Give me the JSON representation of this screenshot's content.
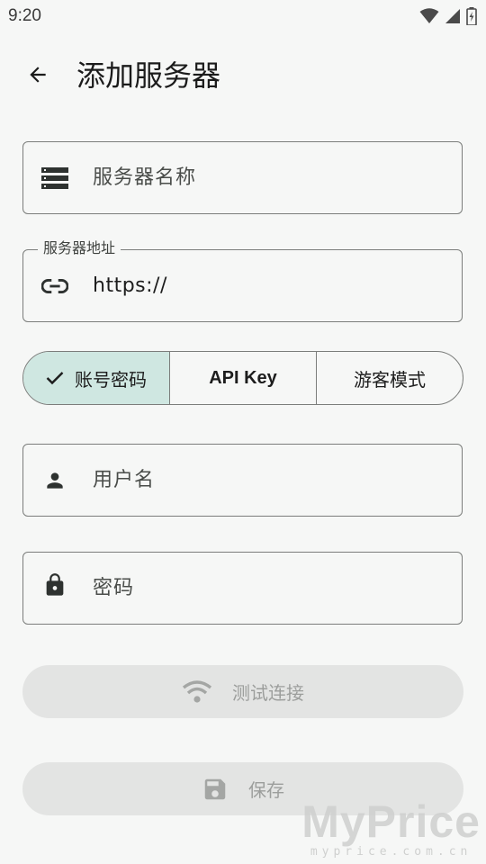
{
  "status_bar": {
    "time": "9:20",
    "icons": [
      "wifi-icon",
      "signal-icon",
      "battery-icon"
    ]
  },
  "app_bar": {
    "back_icon": "arrow-back-icon",
    "title": "添加服务器"
  },
  "server_name": {
    "icon": "server-list-icon",
    "placeholder": "服务器名称"
  },
  "server_address": {
    "icon": "link-icon",
    "label": "服务器地址",
    "value": "https://"
  },
  "auth_mode": {
    "options": [
      {
        "label": "账号密码",
        "selected": true
      },
      {
        "label": "API Key",
        "selected": false
      },
      {
        "label": "游客模式",
        "selected": false
      }
    ]
  },
  "username": {
    "icon": "person-icon",
    "placeholder": "用户名"
  },
  "password": {
    "icon": "lock-icon",
    "placeholder": "密码"
  },
  "test_button": {
    "icon": "wifi-icon",
    "label": "测试连接"
  },
  "save_button": {
    "icon": "save-icon",
    "label": "保存"
  },
  "watermark": {
    "main": "MyPrice",
    "sub": "myprice.com.cn"
  },
  "colors": {
    "background": "#f6f7f6",
    "selected_segment": "#cfe7e1",
    "disabled_button": "#e3e4e3",
    "outline": "#7b7d7b",
    "icon_dark": "#2e3230"
  }
}
